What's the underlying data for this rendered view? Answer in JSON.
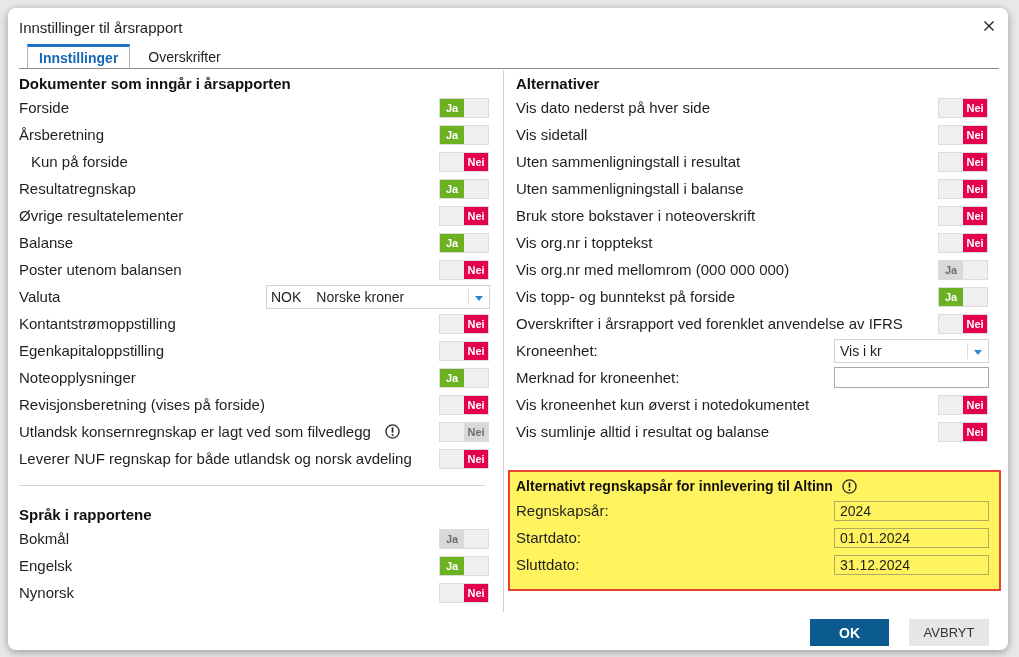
{
  "window": {
    "title": "Innstillinger til årsrapport"
  },
  "tabs": [
    {
      "label": "Innstillinger",
      "selected": true
    },
    {
      "label": "Overskrifter",
      "selected": false
    }
  ],
  "documents": {
    "title": "Dokumenter som inngår i årsapporten",
    "items": [
      {
        "kind": "toggle",
        "label": "Forside",
        "on": true,
        "value": "Ja",
        "disabled": false,
        "notice": false
      },
      {
        "kind": "toggle",
        "label": "Årsberetning",
        "on": true,
        "value": "Ja",
        "disabled": false,
        "notice": false,
        "children": [
          {
            "kind": "toggle",
            "label": "Kun på forside",
            "on": false,
            "value": "Nei",
            "disabled": false,
            "notice": false
          }
        ]
      },
      {
        "kind": "toggle",
        "label": "Resultatregnskap",
        "on": true,
        "value": "Ja",
        "disabled": false,
        "notice": false
      },
      {
        "kind": "toggle",
        "label": "Øvrige resultatelementer",
        "on": false,
        "value": "Nei",
        "disabled": false,
        "notice": false
      },
      {
        "kind": "toggle",
        "label": "Balanse",
        "on": true,
        "value": "Ja",
        "disabled": false,
        "notice": false
      },
      {
        "kind": "toggle",
        "label": "Poster utenom balansen",
        "on": false,
        "value": "Nei",
        "disabled": false,
        "notice": false
      },
      {
        "kind": "select",
        "label": "Valuta",
        "code": "NOK",
        "value": "Norske kroner",
        "notice": false
      },
      {
        "kind": "toggle",
        "label": "Kontantstrømoppstilling",
        "on": false,
        "value": "Nei",
        "disabled": false,
        "notice": false
      },
      {
        "kind": "toggle",
        "label": "Egenkapitaloppstilling",
        "on": false,
        "value": "Nei",
        "disabled": false,
        "notice": false
      },
      {
        "kind": "toggle",
        "label": "Noteopplysninger",
        "on": true,
        "value": "Ja",
        "disabled": false,
        "notice": false
      },
      {
        "kind": "toggle",
        "label": "Revisjonsberetning (vises på forside)",
        "on": false,
        "value": "Nei",
        "disabled": false,
        "notice": false
      },
      {
        "kind": "toggle",
        "label": "Utlandsk konsernregnskap er lagt ved som filvedlegg",
        "on": false,
        "value": "Nei",
        "disabled": true,
        "notice": true
      },
      {
        "kind": "toggle",
        "label": "Leverer NUF regnskap for både utlandsk og norsk avdeling",
        "on": false,
        "value": "Nei",
        "disabled": false,
        "notice": false
      }
    ]
  },
  "languages": {
    "title": "Språk i rapportene",
    "items": [
      {
        "kind": "toggle",
        "label": "Bokmål",
        "on": true,
        "value": "Ja",
        "disabled": true
      },
      {
        "kind": "toggle",
        "label": "Engelsk",
        "on": true,
        "value": "Ja",
        "disabled": false
      },
      {
        "kind": "toggle",
        "label": "Nynorsk",
        "on": false,
        "value": "Nei",
        "disabled": false
      }
    ]
  },
  "alternatives": {
    "title": "Alternativer",
    "items": [
      {
        "kind": "toggle",
        "label": "Vis dato nederst på hver side",
        "on": false,
        "value": "Nei",
        "disabled": false
      },
      {
        "kind": "toggle",
        "label": "Vis sidetall",
        "on": false,
        "value": "Nei",
        "disabled": false
      },
      {
        "kind": "toggle",
        "label": "Uten sammenligningstall i resultat",
        "on": false,
        "value": "Nei",
        "disabled": false
      },
      {
        "kind": "toggle",
        "label": "Uten sammenligningstall i balanse",
        "on": false,
        "value": "Nei",
        "disabled": false
      },
      {
        "kind": "toggle",
        "label": "Bruk store bokstaver i noteoverskrift",
        "on": false,
        "value": "Nei",
        "disabled": false
      },
      {
        "kind": "toggle",
        "label": "Vis org.nr i topptekst",
        "on": false,
        "value": "Nei",
        "disabled": false
      },
      {
        "kind": "toggle",
        "label": "Vis org.nr med mellomrom (000 000 000)",
        "on": true,
        "value": "Ja",
        "disabled": true
      },
      {
        "kind": "toggle",
        "label": "Vis topp- og bunntekst på forside",
        "on": true,
        "value": "Ja",
        "disabled": false
      },
      {
        "kind": "toggle",
        "label": "Overskrifter i årsrapport ved forenklet anvendelse av IFRS",
        "on": false,
        "value": "Nei",
        "disabled": false
      },
      {
        "kind": "select",
        "label": "Kroneenhet:",
        "value": "Vis i kr"
      },
      {
        "kind": "input",
        "label": "Merknad for kroneenhet:"
      },
      {
        "kind": "toggle",
        "label": "Vis kroneenhet kun øverst i notedokumentet",
        "on": false,
        "value": "Nei",
        "disabled": false
      },
      {
        "kind": "toggle",
        "label": "Vis sumlinje alltid i resultat og balanse",
        "on": false,
        "value": "Nei",
        "disabled": false
      }
    ]
  },
  "altinn_period": {
    "title": "Alternativt regnskapsår for innlevering til Altinn",
    "notice": true,
    "highlighted": true,
    "fields": [
      {
        "label": "Regnskapsår:",
        "value": "2024"
      },
      {
        "label": "Startdato:",
        "value": "01.01.2024"
      },
      {
        "label": "Sluttdato:",
        "value": "31.12.2024"
      }
    ]
  },
  "buttons": [
    {
      "label": "OK",
      "kind": "primary"
    },
    {
      "label": "AVBRYT",
      "kind": "secondary"
    }
  ]
}
